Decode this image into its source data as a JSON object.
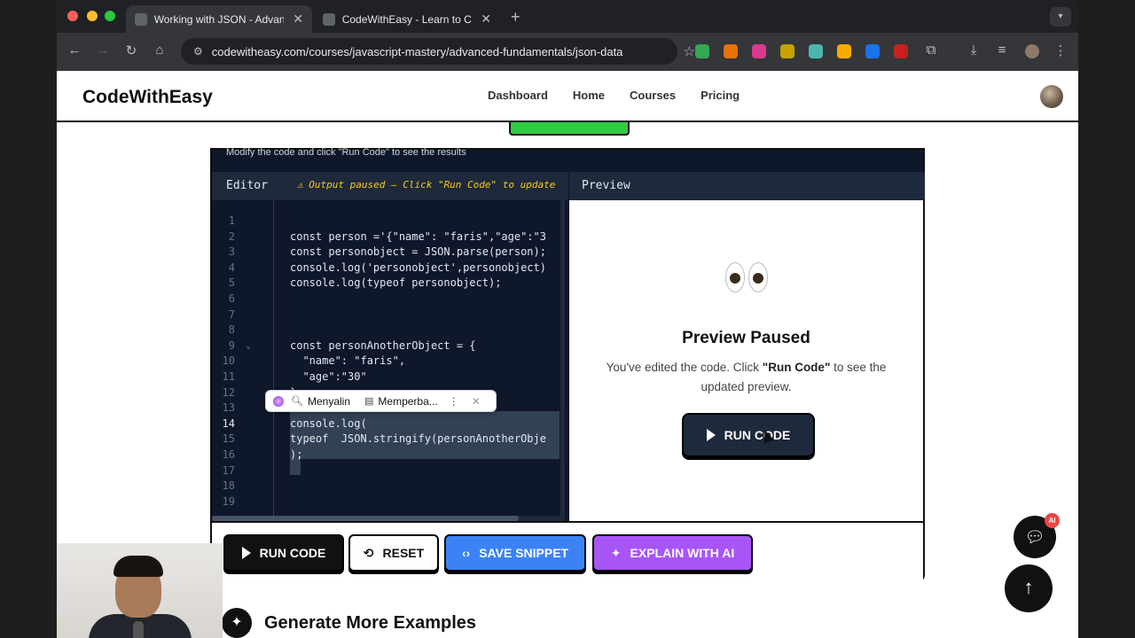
{
  "browser": {
    "tabs": [
      {
        "title": "Working with JSON - Advanced",
        "active": true
      },
      {
        "title": "CodeWithEasy - Learn to Code",
        "active": false
      }
    ],
    "url": "codewitheasy.com/courses/javascript-mastery/advanced-fundamentals/json-data"
  },
  "site": {
    "logo": "CodeWithEasy",
    "nav": [
      "Dashboard",
      "Home",
      "Courses",
      "Pricing"
    ]
  },
  "workspace": {
    "hint": "Modify the code and click \"Run Code\" to see the results",
    "editor_label": "Editor",
    "warning": "⚠ Output paused – Click \"Run Code\" to update",
    "preview_label": "Preview",
    "line_numbers": [
      "1",
      "2",
      "3",
      "4",
      "5",
      "6",
      "7",
      "8",
      "9",
      "10",
      "11",
      "12",
      "13",
      "14",
      "15",
      "16",
      "17",
      "18",
      "19"
    ],
    "current_line": "14",
    "code_lines": {
      "l2": "const person ='{\"name\": \"faris\",\"age\":\"3",
      "l3": "const personobject = JSON.parse(person);",
      "l4": "console.log('personobject',personobject)",
      "l5": "console.log(typeof personobject);",
      "l9": "const personAnotherObject = {",
      "l10": "  \"name\": \"faris\",",
      "l11": "  \"age\":\"30\"",
      "l12": "}",
      "l14": "console.log(",
      "l15": "typeof  JSON.stringify(personAnotherObje",
      "l16": ");"
    },
    "ime_popup": {
      "copy_label": "Menyalin",
      "fix_label": "Memperba..."
    },
    "preview": {
      "title": "Preview Paused",
      "text_before": "You've edited the code. Click ",
      "text_bold": "\"Run Code\"",
      "text_after": " to see the updated preview.",
      "run_button": "RUN CODE"
    },
    "actions": {
      "run": "RUN CODE",
      "reset": "RESET",
      "save": "SAVE SNIPPET",
      "explain": "EXPLAIN WITH AI"
    }
  },
  "generate_more": "Generate More Examples",
  "ai_badge": "AI",
  "colors": {
    "accent_green": "#2ecc40",
    "save_blue": "#3b82f6",
    "ai_purple": "#a855f7",
    "editor_bg": "#0f172a",
    "warning_yellow": "#facc15"
  }
}
